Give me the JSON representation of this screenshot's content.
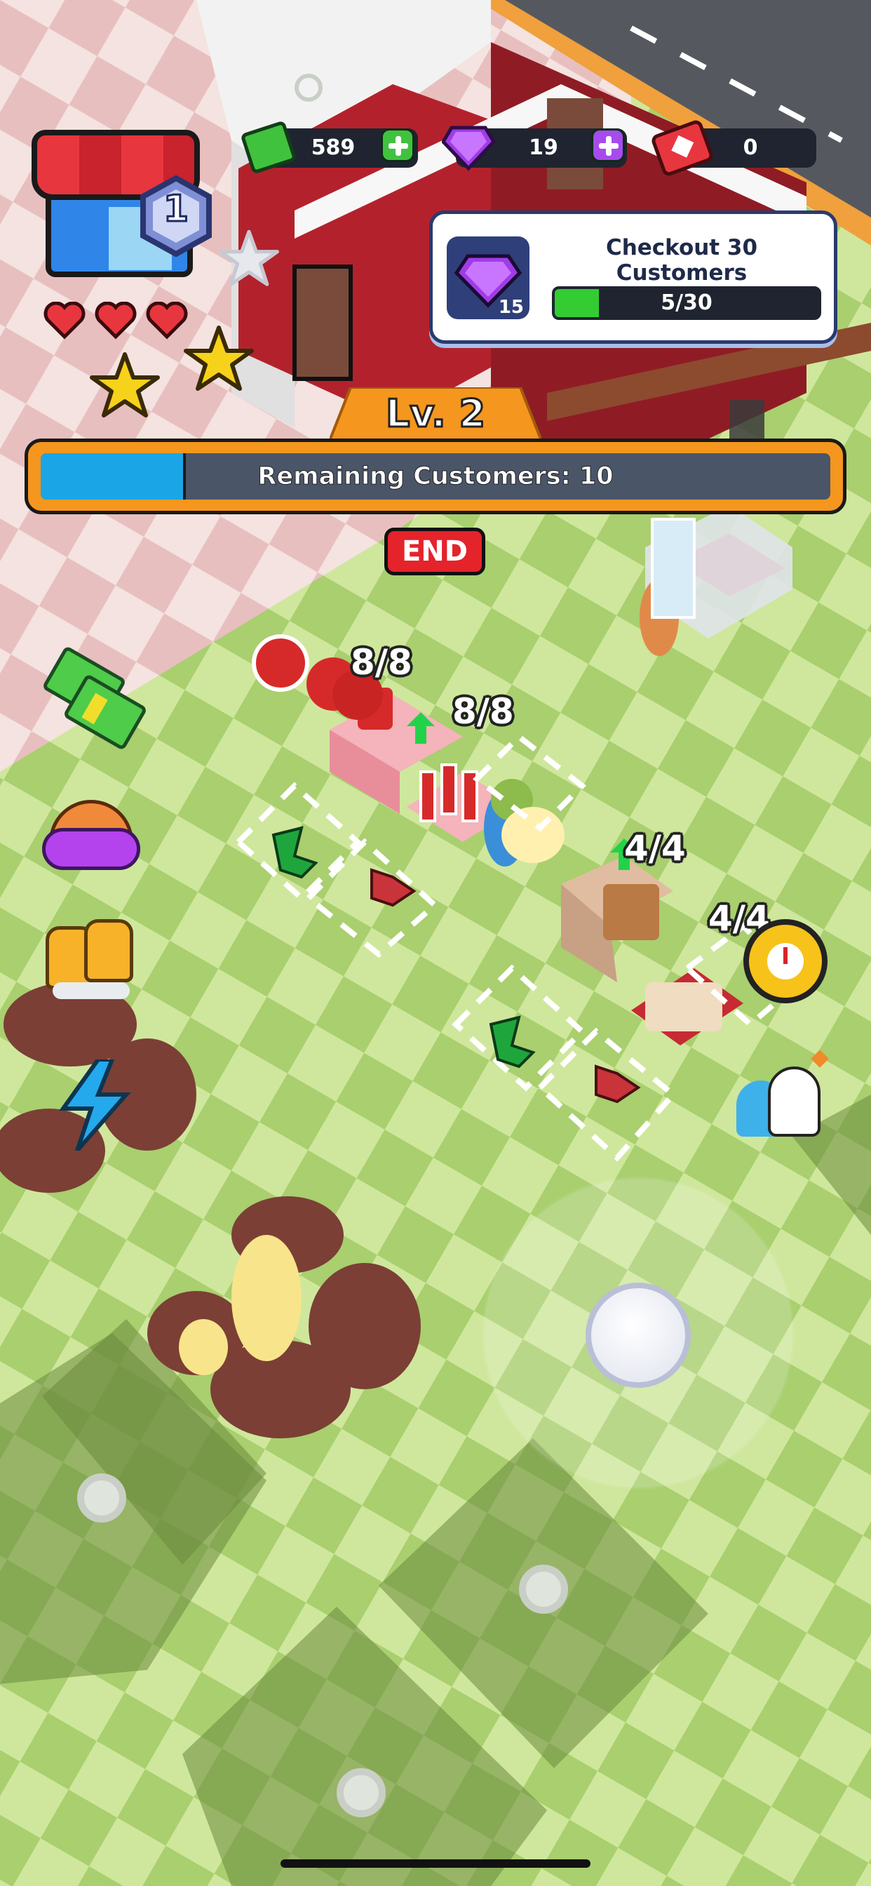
{
  "currency": {
    "cash": "589",
    "gems": "19",
    "tickets": "0"
  },
  "shop": {
    "level_badge": "1",
    "hearts": 3,
    "stars_filled": 2,
    "stars_total": 3
  },
  "quest": {
    "title": "Checkout 30 Customers",
    "reward_count": "15",
    "progress_text": "5/30",
    "progress_fraction": 0.167
  },
  "level": {
    "label": "Lv. 2",
    "status_text": "Remaining Customers: 10",
    "progress_fraction": 0.18,
    "end_button": "END"
  },
  "stations": {
    "tomato_counter": "8/8",
    "drink_counter": "8/8",
    "bread_counter": "4/4",
    "box_counter": "4/4"
  },
  "colors": {
    "cash_green": "#41c23f",
    "gem_purple": "#a03ce6",
    "ticket_red": "#e8363f",
    "level_orange": "#f5961e",
    "progress_blue": "#1aa6e6",
    "quest_green": "#33cc33",
    "end_red": "#e4232b"
  },
  "icons": [
    "cash-icon",
    "gem-icon",
    "ticket-icon",
    "shop-icon",
    "heart-icon",
    "star-icon",
    "cash-stack-icon",
    "gem-pot-icon",
    "boots-icon",
    "lightning-icon",
    "stopwatch-icon",
    "ghost-icon",
    "lock-icon",
    "joystick-knob-icon"
  ]
}
